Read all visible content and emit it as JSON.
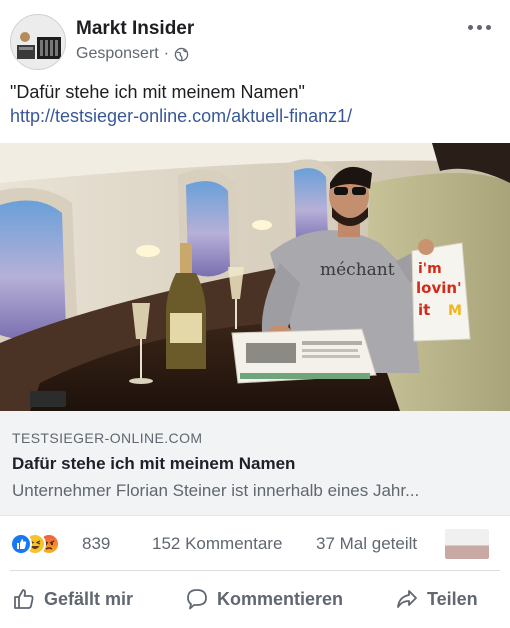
{
  "header": {
    "page_name": "Markt Insider",
    "sponsored": "Gesponsert",
    "separator": "·"
  },
  "post": {
    "text": "\"Dafür stehe ich mit meinem Namen\"",
    "link": "http://testsieger-online.com/aktuell-finanz1/",
    "image": {
      "shirt_text": "méchant",
      "bag_lines": [
        "i'm",
        "lovin'",
        "it"
      ]
    }
  },
  "preview": {
    "domain": "TESTSIEGER-ONLINE.COM",
    "title": "Dafür stehe ich mit meinem Namen",
    "description": "Unternehmer Florian Steiner ist innerhalb eines Jahr..."
  },
  "stats": {
    "reactions": "839",
    "comments": "152 Kommentare",
    "shares": "37 Mal geteilt",
    "reaction_types": [
      "like-icon",
      "haha-icon",
      "angry-icon"
    ]
  },
  "actions": {
    "like": "Gefällt mir",
    "comment": "Kommentieren",
    "share": "Teilen"
  },
  "colors": {
    "link": "#385898",
    "muted": "#606770",
    "like_blue": "#1877f2",
    "preview_bg": "#f2f3f5"
  }
}
